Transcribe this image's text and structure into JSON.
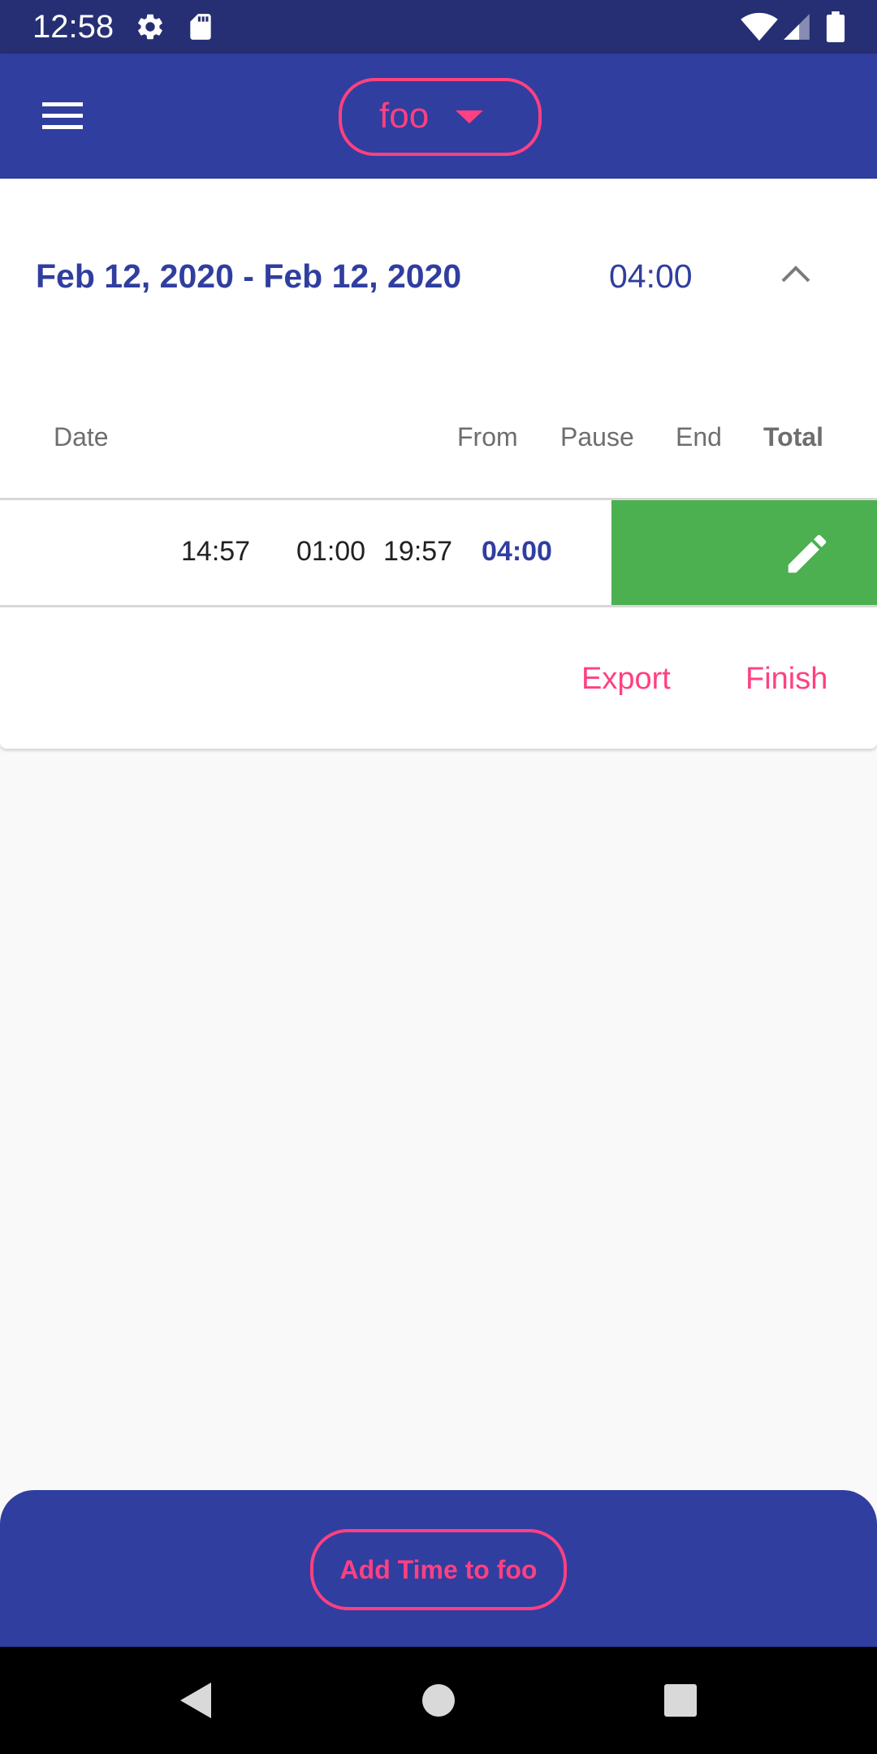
{
  "status_bar": {
    "time": "12:58",
    "icons": [
      "settings-icon",
      "sd-card-icon",
      "wifi-icon",
      "signal-icon",
      "battery-icon"
    ]
  },
  "app_bar": {
    "menu_icon": "hamburger-menu-icon",
    "project_name": "foo",
    "dropdown_icon": "caret-down-icon"
  },
  "card": {
    "date_range": "Feb 12, 2020 - Feb 12, 2020",
    "total": "04:00",
    "collapse_icon": "chevron-up-icon",
    "columns": {
      "date": "Date",
      "from": "From",
      "pause": "Pause",
      "end": "End",
      "total": "Total"
    },
    "entry": {
      "from": "14:57",
      "pause": "01:00",
      "end": "19:57",
      "total": "04:00",
      "edit_icon": "pencil-icon"
    },
    "actions": {
      "export": "Export",
      "finish": "Finish"
    }
  },
  "bottom_sheet": {
    "add_button": "Add Time to foo"
  },
  "nav_bar": {
    "icons": [
      "back-icon",
      "home-icon",
      "recents-icon"
    ]
  },
  "colors": {
    "status_bar": "#262f73",
    "primary": "#303e9f",
    "accent": "#ff4081",
    "edit_swipe": "#4caf50",
    "background": "#f9f9f9"
  }
}
